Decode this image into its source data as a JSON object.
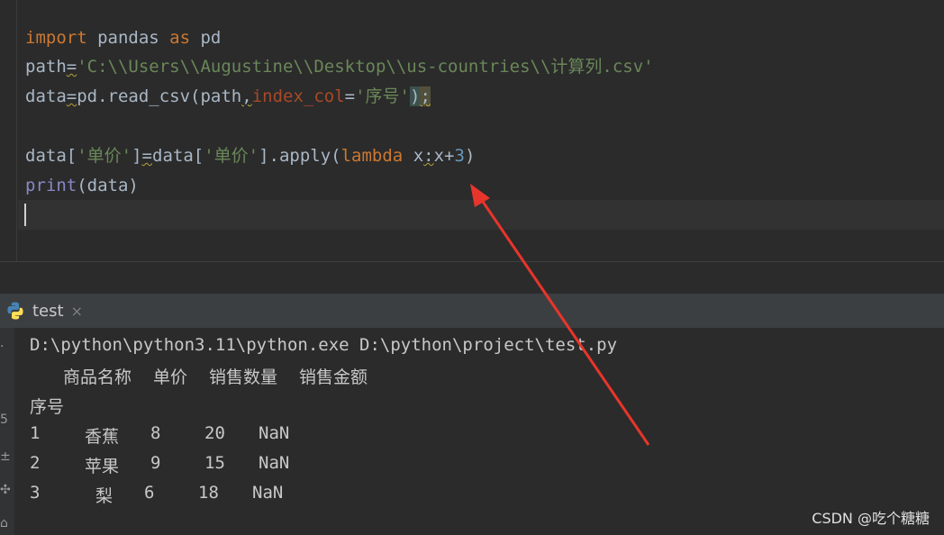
{
  "editor": {
    "line1": {
      "kw1": "import",
      "mid": " pandas ",
      "kw2": "as",
      "end": " pd"
    },
    "line2": {
      "var": "path",
      "eq": "=",
      "str": "'C:\\\\Users\\\\Augustine\\\\Desktop\\\\us-countries\\\\计算列.csv'"
    },
    "line3": {
      "start": "data",
      "eq": "=",
      "call": "pd.read_csv(path",
      "comma": ",",
      "param": "index_col",
      "eq2": "=",
      "str": "'序号'",
      "close": ")",
      "semi": ";"
    },
    "line5": {
      "a": "data[",
      "s1": "'单价'",
      "b": "]",
      "eq": "=",
      "c": "data[",
      "s2": "'单价'",
      "d": "].apply(",
      "kw": "lambda",
      "e": " x",
      "colon": ":",
      "f": "x+",
      "num": "3",
      "g": ")"
    },
    "line6": {
      "fn": "print",
      "arg": "(data)"
    }
  },
  "run_tab": {
    "label": "test",
    "close": "×"
  },
  "console": {
    "command": "D:\\python\\python3.11\\python.exe D:\\python\\project\\test.py",
    "headers": [
      "商品名称",
      "单价",
      "销售数量",
      "销售金额"
    ],
    "index_name": "序号",
    "rows": [
      {
        "idx": "1",
        "name": "香蕉",
        "price": "8",
        "qty": "20",
        "amount": "NaN"
      },
      {
        "idx": "2",
        "name": "苹果",
        "price": "9",
        "qty": "15",
        "amount": "NaN"
      },
      {
        "idx": "3",
        "name": "梨",
        "price": "6",
        "qty": "18",
        "amount": "NaN"
      }
    ]
  },
  "watermark": "CSDN @吃个糖糖",
  "colors": {
    "keyword": "#cc7832",
    "string": "#6a8759",
    "number": "#6897bb",
    "builtin": "#8888c6",
    "param": "#aa4926",
    "arrow": "#e8352b"
  }
}
